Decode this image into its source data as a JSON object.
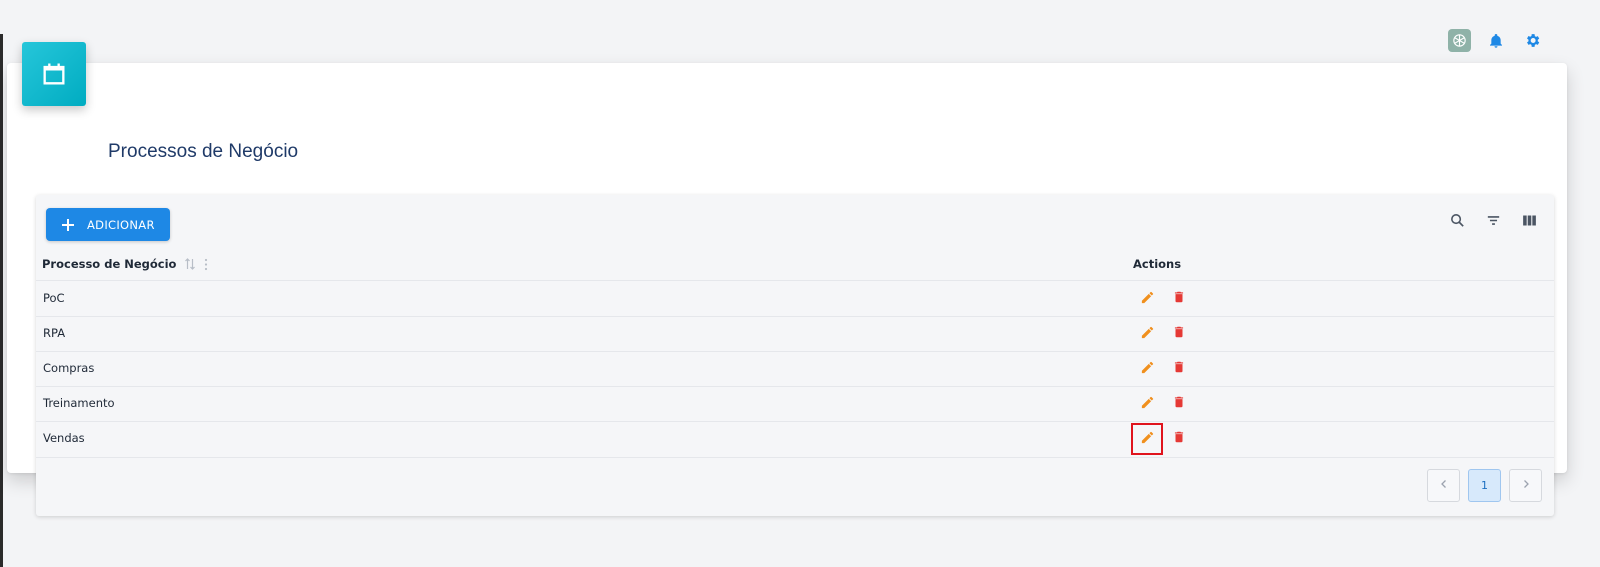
{
  "page": {
    "title": "Processos de Negócio"
  },
  "toolbar": {
    "add_label": "ADICIONAR"
  },
  "table": {
    "columns": {
      "name": "Processo de Negócio",
      "actions": "Actions"
    },
    "rows": [
      {
        "name": "PoC"
      },
      {
        "name": "RPA"
      },
      {
        "name": "Compras"
      },
      {
        "name": "Treinamento"
      },
      {
        "name": "Vendas"
      }
    ]
  },
  "pagination": {
    "current_page": "1"
  },
  "colors": {
    "accent": "#1e88e5",
    "edit": "#f0901e",
    "delete": "#e53935",
    "header_icon": "#00acc1",
    "highlight": "#e0141d"
  },
  "icons": [
    "app-logo-icon",
    "bell-icon",
    "gear-icon",
    "calendar-icon",
    "plus-icon",
    "search-icon",
    "filter-icon",
    "columns-icon",
    "sort-icon",
    "column-menu-icon",
    "pencil-icon",
    "trash-icon",
    "chevron-left-icon",
    "chevron-right-icon"
  ],
  "state": {
    "highlighted_row_action": "edit Vendas"
  }
}
